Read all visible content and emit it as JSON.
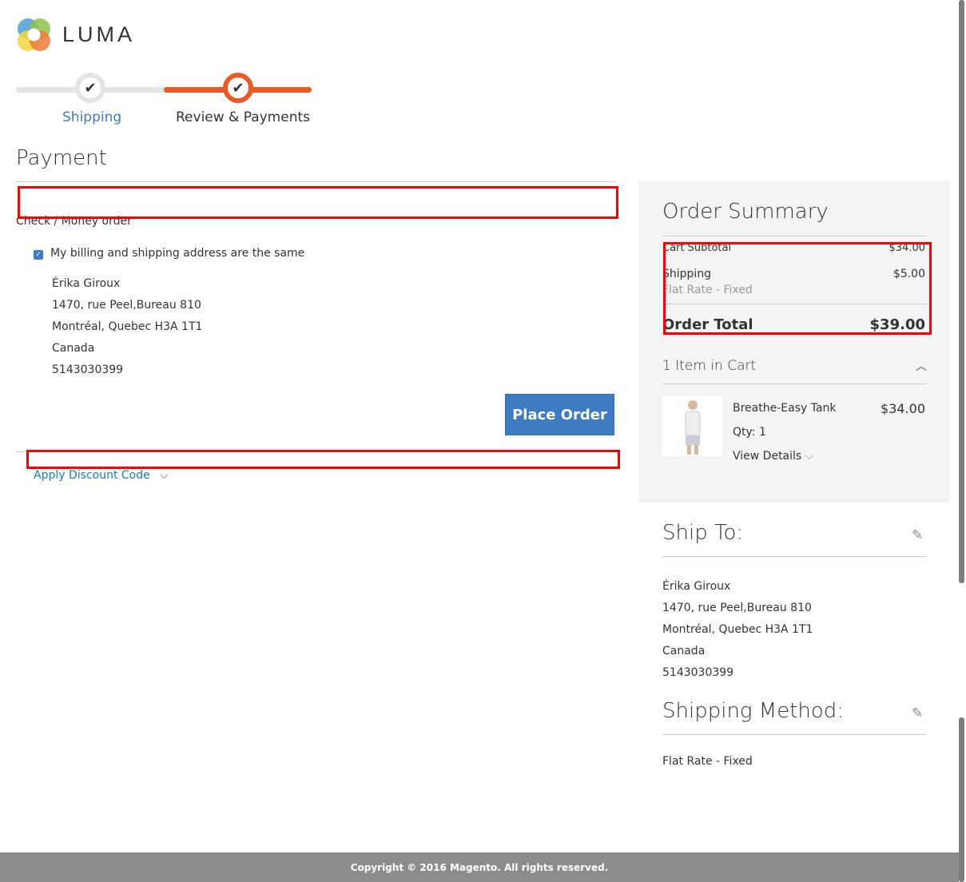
{
  "brand": {
    "name": "LUMA"
  },
  "progress": {
    "steps": [
      {
        "label": "Shipping",
        "state": "complete"
      },
      {
        "label": "Review & Payments",
        "state": "active"
      }
    ]
  },
  "payment": {
    "title": "Payment",
    "method": "Check / Money order",
    "same_address_label": "My billing and shipping address are the same",
    "same_address_checked": true,
    "address": [
      "Érika Giroux",
      "1470, rue Peel,Bureau 810",
      "Montréal, Quebec H3A 1T1",
      "Canada",
      "5143030399"
    ],
    "place_order": "Place Order",
    "discount_link": "Apply Discount Code"
  },
  "summary": {
    "title": "Order Summary",
    "subtotal_label": "Cart Subtotal",
    "subtotal": "$34.00",
    "shipping_label": "Shipping",
    "shipping": "$5.00",
    "shipping_method": "Flat Rate - Fixed",
    "total_label": "Order Total",
    "total": "$39.00",
    "items_in_cart": "1 Item in Cart",
    "item": {
      "name": "Breathe-Easy Tank",
      "price": "$34.00",
      "qty": "Qty: 1",
      "details": "View Details"
    }
  },
  "ship_to": {
    "title": "Ship To:",
    "address": [
      "Érika Giroux",
      "1470, rue Peel,Bureau 810",
      "Montréal, Quebec H3A 1T1",
      "Canada",
      "5143030399"
    ]
  },
  "shipping_method": {
    "title": "Shipping Method:",
    "value": "Flat Rate - Fixed"
  },
  "footer": {
    "copyright": "Copyright © 2016 Magento. All rights reserved."
  },
  "colors": {
    "accent": "#eb5a24",
    "link": "#1979c3",
    "button": "#3d7bc3"
  }
}
